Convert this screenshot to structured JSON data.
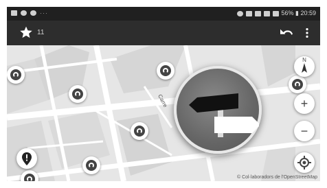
{
  "status_bar": {
    "left_dots": "···",
    "right_text": "56% ▮ 20:59"
  },
  "toolbar": {
    "favorites_count": "11",
    "star_icon": "star-icon",
    "undo_icon": "undo-icon",
    "overflow_icon": "more-vert-icon"
  },
  "map": {
    "street_label": "Carre",
    "attribution": "© Col·laboradors de l'OpenStreetMap",
    "compass_label": "N",
    "zoom_in_label": "+",
    "zoom_out_label": "−"
  },
  "colors": {
    "toolbar_bg": "#2d2d2d",
    "status_bg": "#202020",
    "map_bg": "#e6e6e6",
    "badge_sign": "#111111"
  }
}
